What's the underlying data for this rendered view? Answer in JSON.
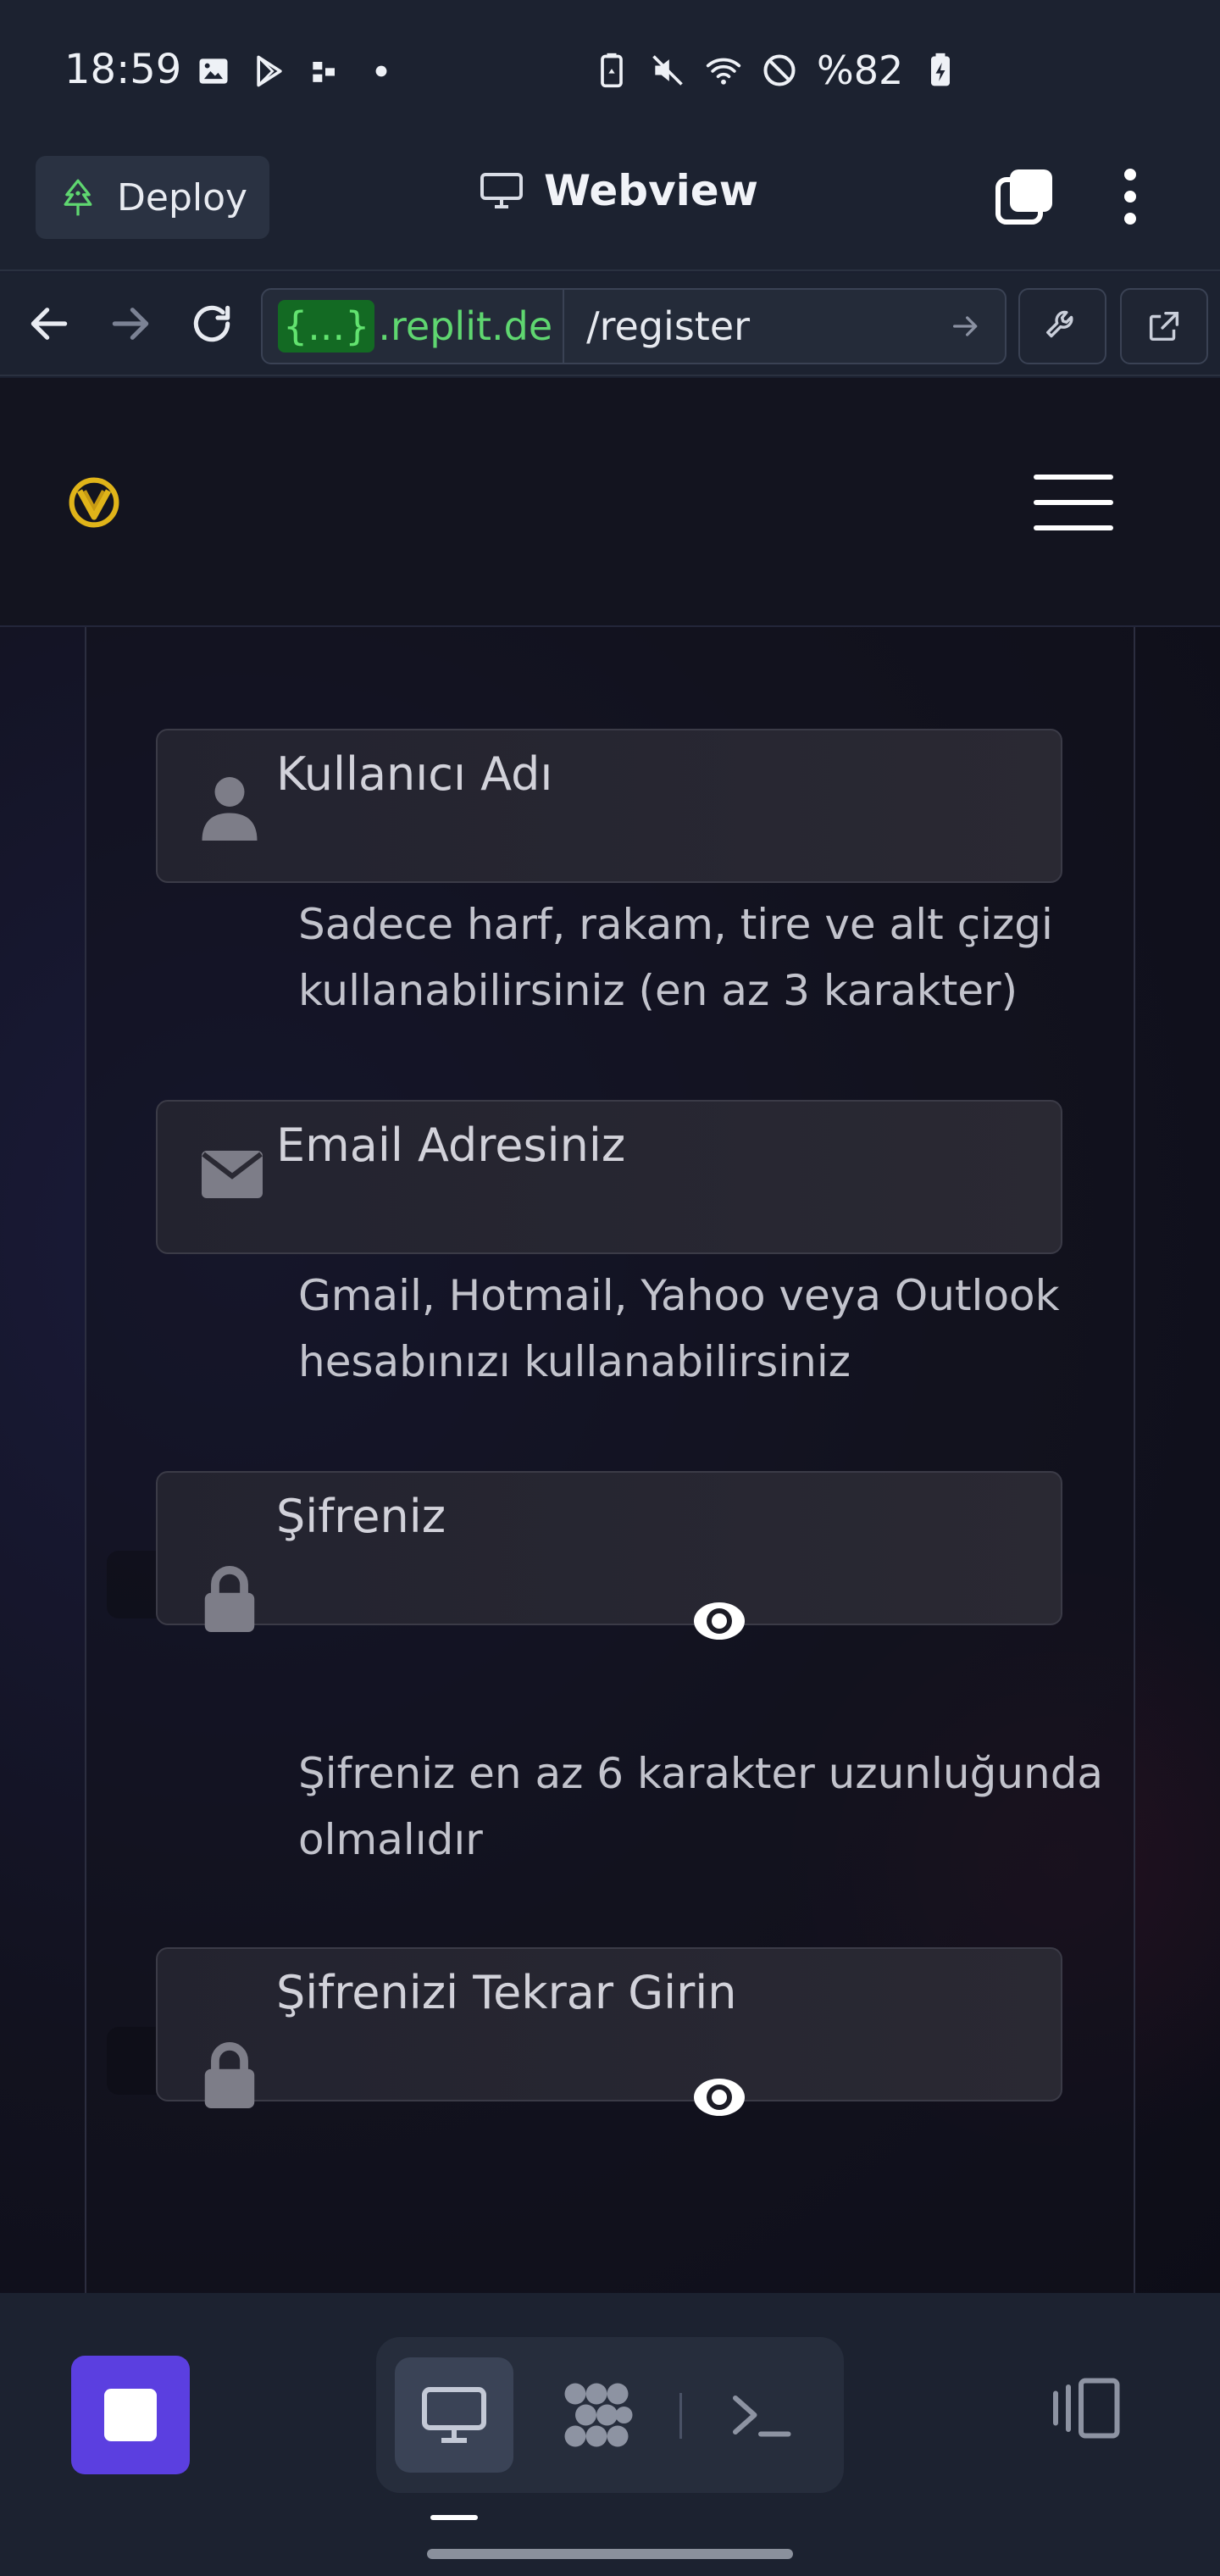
{
  "status_bar": {
    "time": "18:59",
    "battery": "%82"
  },
  "webview_header": {
    "deploy_label": "Deploy",
    "title": "Webview"
  },
  "url_bar": {
    "host_chip": "{...}",
    "host_rest": ".replit.de",
    "path": "/register"
  },
  "form": {
    "username": {
      "label": "Kullanıcı Adı",
      "help": "Sadece harf, rakam, tire ve alt çizgi kullanabilirsiniz (en az 3 karakter)"
    },
    "email": {
      "label": "Email Adresiniz",
      "help": "Gmail, Hotmail, Yahoo veya Outlook hesabınızı kullanabilirsiniz"
    },
    "password": {
      "label": "Şifreniz",
      "help": "Şifreniz en az 6 karakter uzunluğunda olmalıdır"
    },
    "password_confirm": {
      "label": "Şifrenizi Tekrar Girin"
    }
  },
  "colors": {
    "accent_purple": "#5b3fe0",
    "replit_green": "#5fd670",
    "logo_gold": "#e0b419"
  },
  "icons": {
    "status": [
      "image-icon",
      "play-store-icon",
      "dots-app-icon",
      "battery-saver-icon",
      "mute-icon",
      "wifi-icon",
      "dnd-icon",
      "battery-icon"
    ],
    "fields": [
      "user-icon",
      "envelope-icon",
      "lock-icon",
      "eye-icon"
    ],
    "bottom": [
      "stop-icon",
      "monitor-icon",
      "cluster-icon",
      "terminal-icon",
      "layout-icon"
    ]
  }
}
